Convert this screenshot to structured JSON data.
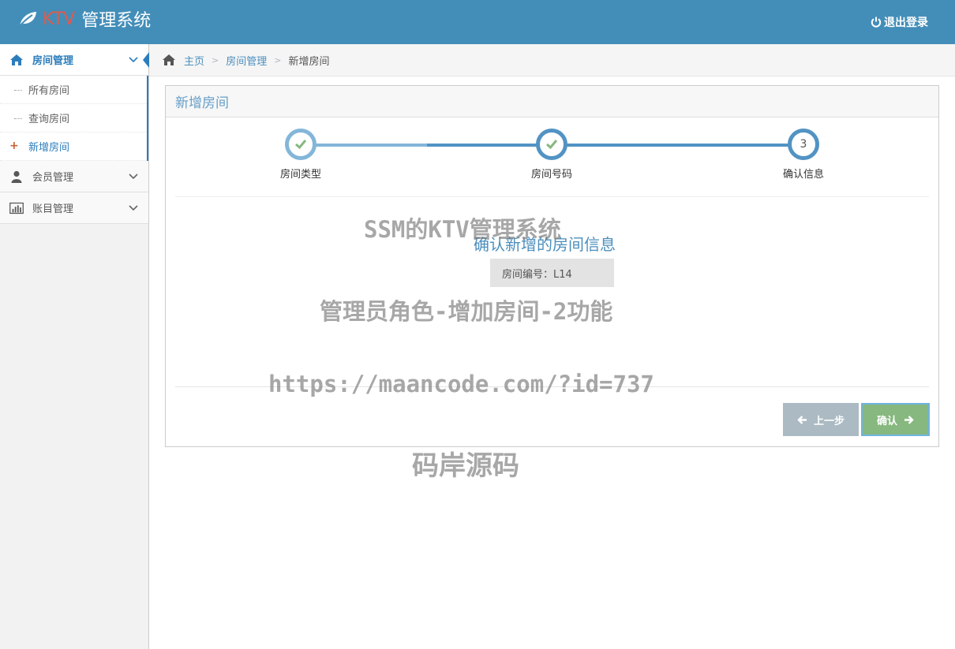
{
  "app": {
    "brand_prefix": "KTV",
    "brand_title": "管理系统",
    "logout_label": "退出登录",
    "brand_accent": "#e25a4a",
    "header_color": "#438eb9"
  },
  "sidebar": {
    "items": [
      {
        "label": "房间管理",
        "icon": "home-icon",
        "active": true,
        "children": [
          {
            "label": "所有房间"
          },
          {
            "label": "查询房间"
          },
          {
            "label": "新增房间",
            "current": true
          }
        ]
      },
      {
        "label": "会员管理",
        "icon": "user-icon"
      },
      {
        "label": "账目管理",
        "icon": "bar-chart-icon"
      }
    ]
  },
  "breadcrumb": {
    "home": "主页",
    "section": "房间管理",
    "current": "新增房间"
  },
  "widget": {
    "title": "新增房间",
    "steps": [
      {
        "title": "房间类型",
        "status": "complete"
      },
      {
        "title": "房间号码",
        "status": "complete"
      },
      {
        "title": "确认信息",
        "number": "3",
        "status": "active"
      }
    ],
    "confirm_title": "确认新增的房间信息",
    "room_number_text": "房间编号：L14",
    "prev_label": "上一步",
    "confirm_label": "确认"
  },
  "watermarks": {
    "line1": "SSM的KTV管理系统",
    "line2": "管理员角色-增加房间-2功能",
    "line3": "https://maancode.com/?id=737",
    "line4": "码岸源码"
  }
}
